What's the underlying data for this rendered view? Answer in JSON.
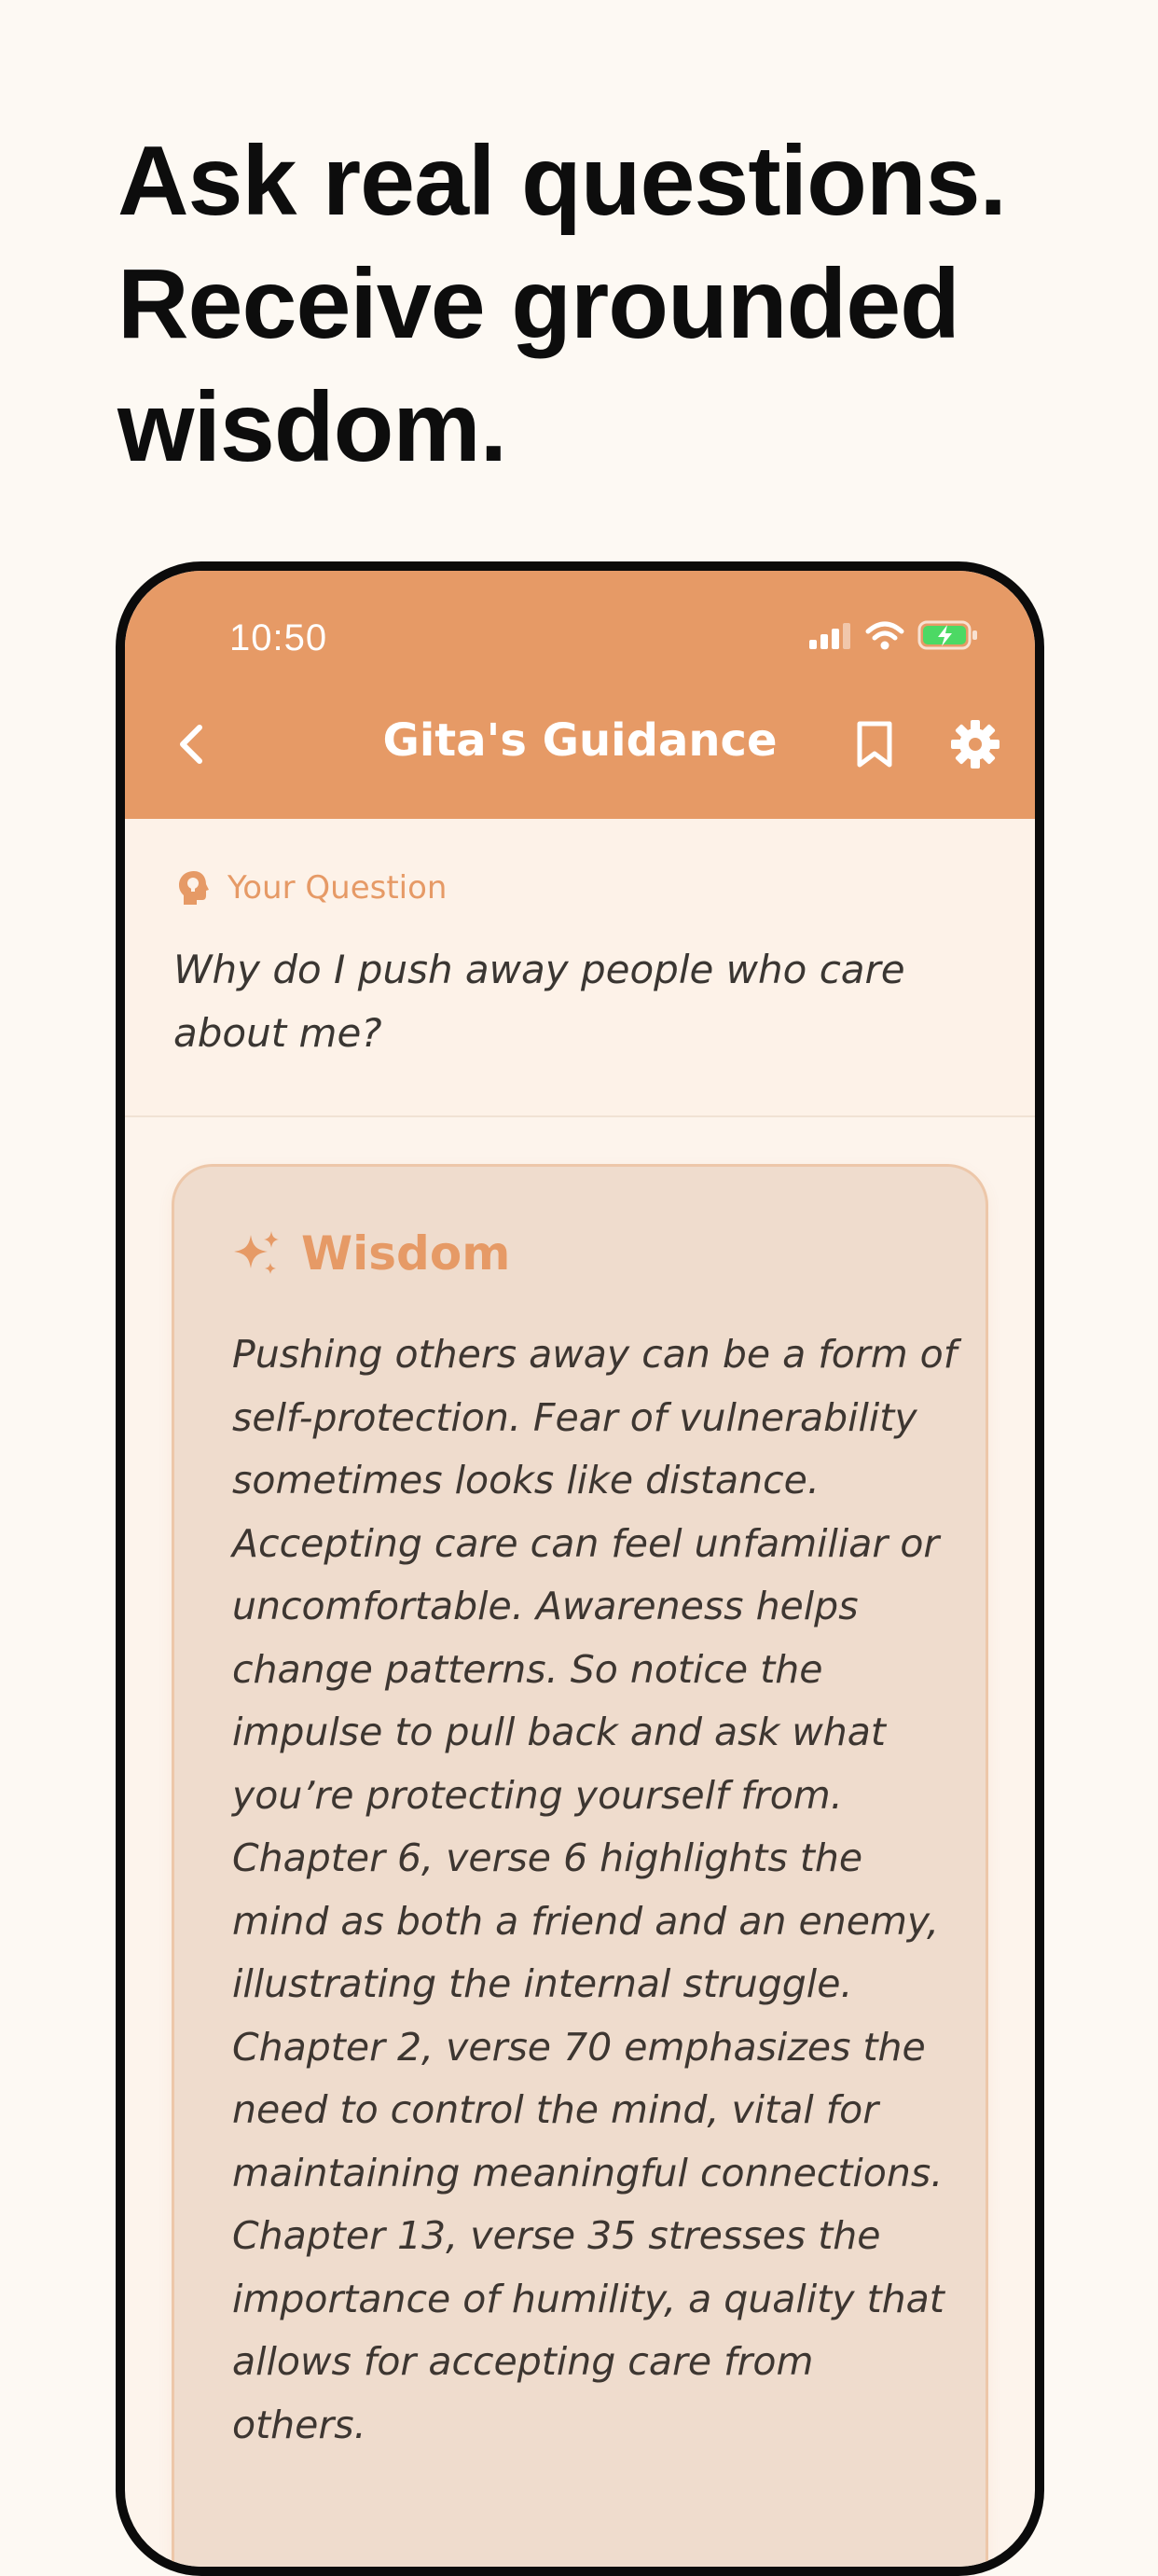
{
  "headline": {
    "line1": "Ask real questions.",
    "line2": "Receive grounded",
    "line3": "wisdom."
  },
  "status_bar": {
    "time": "10:50"
  },
  "nav": {
    "title": "Gita's Guidance"
  },
  "question": {
    "label": "Your Question",
    "text": "Why do I push away people who care about me?"
  },
  "wisdom": {
    "title": "Wisdom",
    "text": "Pushing others away can be a form of self-protection. Fear of vulnerability sometimes looks like distance. Accepting care can feel unfamiliar or uncomfortable. Awareness helps change patterns. So notice the impulse to pull back and ask what you’re protecting yourself from. Chapter 6, verse 6 highlights the mind as both a friend and an enemy, illustrating the internal struggle. Chapter 2, verse 70 emphasizes the need to control the mind, vital for maintaining meaningful connections. Chapter 13, verse 35 stresses the importance of humility, a quality that allows for accepting care from others."
  },
  "colors": {
    "accent": "#e69a66",
    "background": "#fdf9f3",
    "card": "#efdccd",
    "battery": "#4cd964"
  },
  "icons": {
    "back": "chevron-left-icon",
    "bookmark": "bookmark-icon",
    "settings": "gear-icon",
    "question": "head-lightbulb-icon",
    "wisdom": "sparkles-icon",
    "signal": "signal-icon",
    "wifi": "wifi-icon",
    "battery": "battery-charging-icon"
  }
}
